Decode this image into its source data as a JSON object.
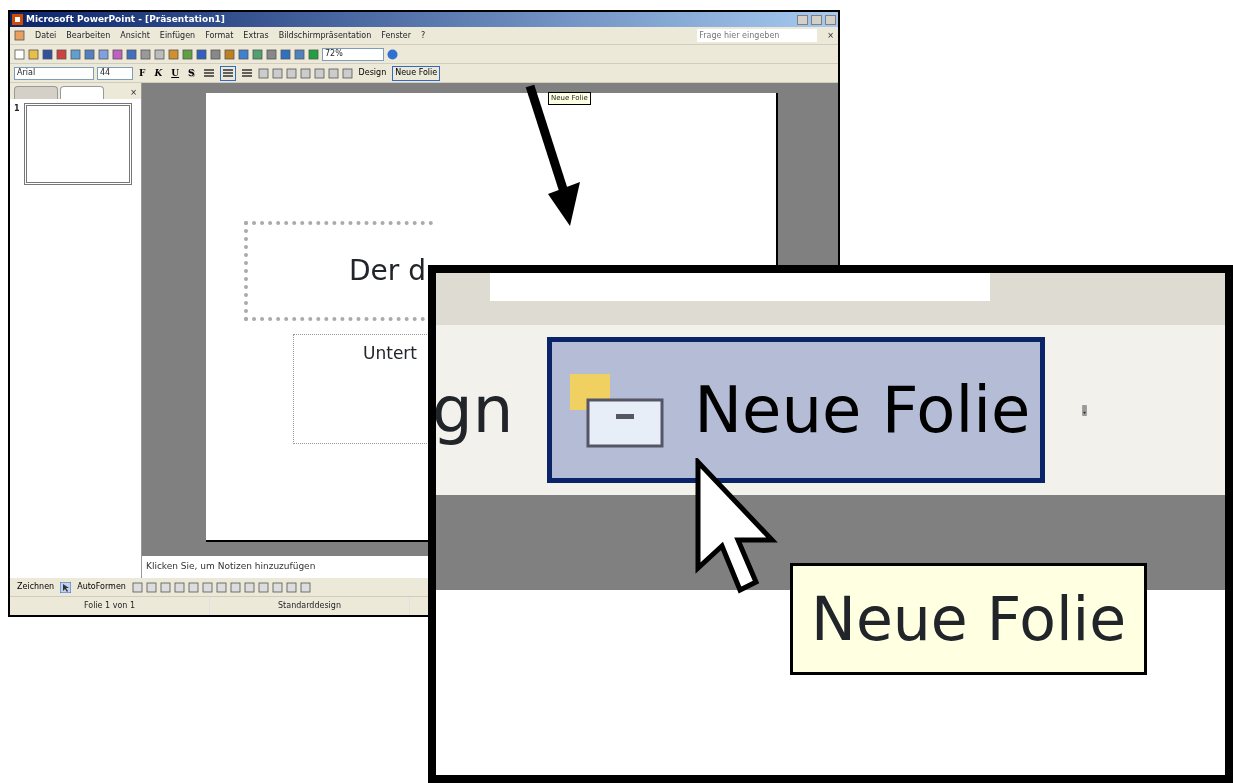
{
  "window": {
    "title": "Microsoft PowerPoint - [Präsentation1]"
  },
  "menu": [
    "Datei",
    "Bearbeiten",
    "Ansicht",
    "Einfügen",
    "Format",
    "Extras",
    "Bildschirmpräsentation",
    "Fenster",
    "?"
  ],
  "help_box": {
    "placeholder": "Frage hier eingeben"
  },
  "document_close": "×",
  "pane_close": "×",
  "zoom": "72%",
  "font": "Arial",
  "font_size": "44",
  "format_buttons": [
    {
      "label": "F",
      "kind": "bold"
    },
    {
      "label": "K",
      "kind": "italic"
    },
    {
      "label": "U",
      "kind": "underline"
    },
    {
      "label": "S",
      "kind": "shadow"
    }
  ],
  "align_buttons": [
    {
      "selected": false
    },
    {
      "selected": true
    },
    {
      "selected": false
    }
  ],
  "toolbar_buttons": [
    {
      "label": "Design",
      "selected": false
    },
    {
      "label": "Neue Folie",
      "selected": true
    }
  ],
  "tooltip": "Neue Folie",
  "pane_tabs": [
    {
      "selected": false
    },
    {
      "selected": true
    }
  ],
  "slides": [
    {
      "number": "1",
      "selected": true
    }
  ],
  "slide": {
    "title": "Der d",
    "subtitle": "Untert"
  },
  "notes": {
    "placeholder": "Klicken Sie, um Notizen hinzuzufügen"
  },
  "drawing_toolbar": [
    "Zeichnen",
    "AutoFormen"
  ],
  "status_bar": [
    "Folie 1 von 1",
    "Standarddesign"
  ],
  "magnified": {
    "partial_label": "gn",
    "button": {
      "label": "Neue Folie",
      "selected": true
    },
    "tooltip": "Neue Folie"
  }
}
